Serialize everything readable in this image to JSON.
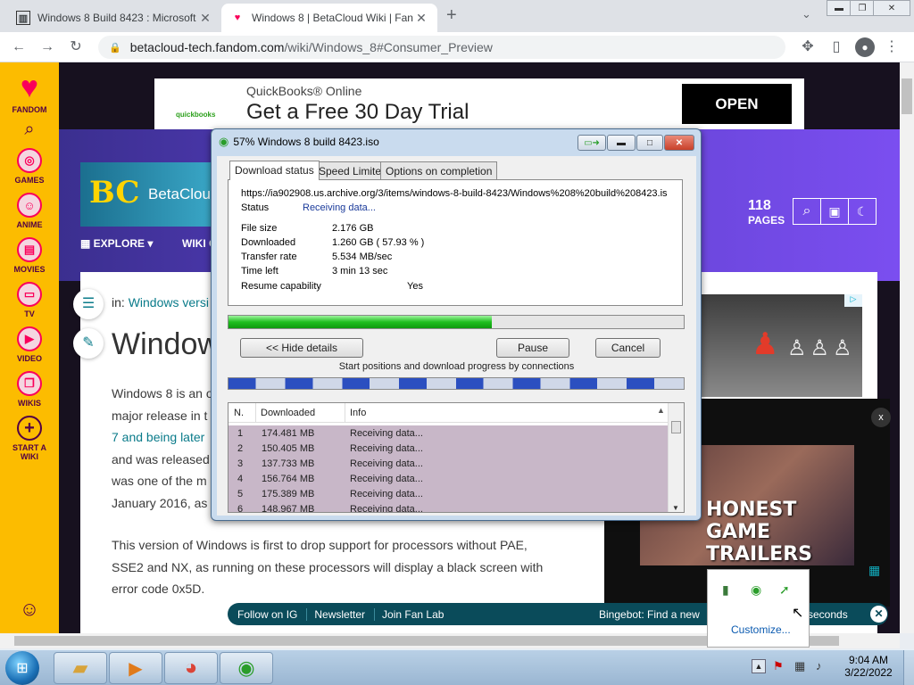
{
  "browser": {
    "tabs": [
      {
        "title": "Windows 8 Build 8423 : Microsoft"
      },
      {
        "title": "Windows 8 | BetaCloud Wiki | Fan"
      }
    ],
    "url_host": "betacloud-tech.fandom.com",
    "url_path": "/wiki/Windows_8#Consumer_Preview"
  },
  "fandom": {
    "logo": "FANDOM",
    "rail": [
      {
        "label": "GAMES"
      },
      {
        "label": "ANIME"
      },
      {
        "label": "MOVIES"
      },
      {
        "label": "TV"
      },
      {
        "label": "VIDEO"
      },
      {
        "label": "WIKIS"
      },
      {
        "label": "START A WIKI"
      }
    ],
    "explore": "EXPLORE",
    "wiki_nav": "WIKI C",
    "wiki_name": "BetaClou",
    "pages_count": "118",
    "pages_label": "PAGES",
    "breadcrumb_prefix": "in:",
    "breadcrumb_link": "Windows versi",
    "title": "Window",
    "para1": [
      "Windows 8 is an o",
      "major release in t",
      "7 and being later",
      "and was released",
      "was one of the m",
      "January 2016, as"
    ],
    "para2": "This version of Windows is first to drop support for processors without PAE, SSE2 and NX, as running on these processors will display a black screen with error code 0x5D."
  },
  "ad": {
    "brand": "QuickBooks® Online",
    "headline": "Get a Free 30 Day Trial",
    "cta": "OPEN",
    "logo": "quickbooks"
  },
  "video": {
    "close": "x",
    "caption": "HONEST GAME TRAILERS"
  },
  "fanbar": {
    "items": [
      "Follow on IG",
      "Newsletter",
      "Join Fan Lab"
    ],
    "ticker_left": "Bingebot: Find a new",
    "ticker_right": "seconds"
  },
  "download": {
    "title": "57% Windows 8 build 8423.iso",
    "tabs": [
      "Download status",
      "Speed Limiter",
      "Options on completion"
    ],
    "url": "https://ia902908.us.archive.org/3/items/windows-8-build-8423/Windows%208%20build%208423.is",
    "status_label": "Status",
    "status_value": "Receiving data...",
    "fields": [
      {
        "label": "File size",
        "value": "2.176  GB"
      },
      {
        "label": "Downloaded",
        "value": "1.260  GB  ( 57.93 % )"
      },
      {
        "label": "Transfer rate",
        "value": "5.534  MB/sec"
      },
      {
        "label": "Time left",
        "value": "3 min 13 sec"
      }
    ],
    "resume_label": "Resume capability",
    "resume_value": "Yes",
    "progress": 0.5793,
    "hide_details": "<< Hide details",
    "pause": "Pause",
    "cancel": "Cancel",
    "conn_caption": "Start positions and download progress by connections",
    "columns": [
      "N.",
      "Downloaded",
      "Info"
    ],
    "connections": [
      {
        "n": "1",
        "dl": "174.481  MB",
        "info": "Receiving data..."
      },
      {
        "n": "2",
        "dl": "150.405  MB",
        "info": "Receiving data..."
      },
      {
        "n": "3",
        "dl": "137.733  MB",
        "info": "Receiving data..."
      },
      {
        "n": "4",
        "dl": "156.764  MB",
        "info": "Receiving data..."
      },
      {
        "n": "5",
        "dl": "175.389  MB",
        "info": "Receiving data..."
      },
      {
        "n": "6",
        "dl": "148.967  MB",
        "info": "Receiving data..."
      }
    ]
  },
  "tray": {
    "customize": "Customize...",
    "time": "9:04 AM",
    "date": "3/22/2022"
  }
}
